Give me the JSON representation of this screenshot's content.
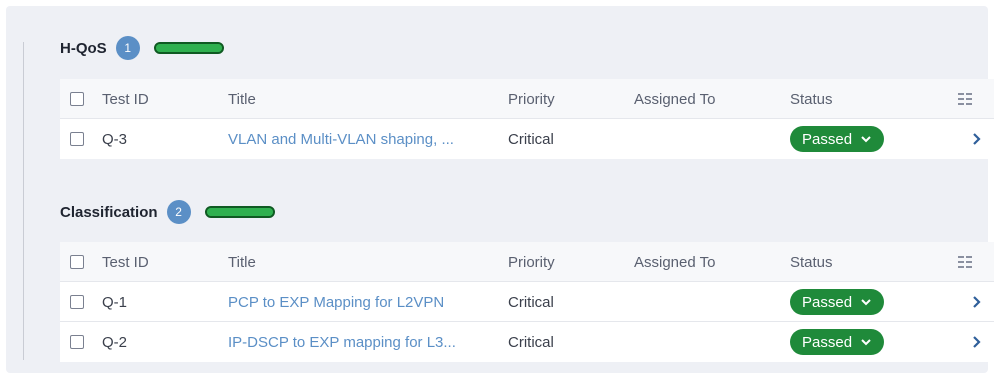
{
  "groups": [
    {
      "title": "H-QoS",
      "count": "1",
      "progress_fraction": 1.0,
      "columns": {
        "test_id": "Test ID",
        "title": "Title",
        "priority": "Priority",
        "assigned_to": "Assigned To",
        "status": "Status"
      },
      "rows": [
        {
          "test_id": "Q-3",
          "title": "VLAN and Multi-VLAN shaping, ...",
          "priority": "Critical",
          "assigned_to": "",
          "status": "Passed"
        }
      ]
    },
    {
      "title": "Classification",
      "count": "2",
      "progress_fraction": 1.0,
      "columns": {
        "test_id": "Test ID",
        "title": "Title",
        "priority": "Priority",
        "assigned_to": "Assigned To",
        "status": "Status"
      },
      "rows": [
        {
          "test_id": "Q-1",
          "title": "PCP to EXP Mapping for L2VPN",
          "priority": "Critical",
          "assigned_to": "",
          "status": "Passed"
        },
        {
          "test_id": "Q-2",
          "title": "IP-DSCP to EXP mapping for L3...",
          "priority": "Critical",
          "assigned_to": "",
          "status": "Passed"
        }
      ]
    }
  ],
  "colors": {
    "status_passed": "#1f8a3a",
    "link": "#5b8fc6",
    "badge": "#5b8fc6",
    "progress": "#2fb04f"
  },
  "icons": {
    "column_menu": "columns-icon",
    "row_open": "chevron-right-icon",
    "status_dropdown": "chevron-down-icon"
  }
}
